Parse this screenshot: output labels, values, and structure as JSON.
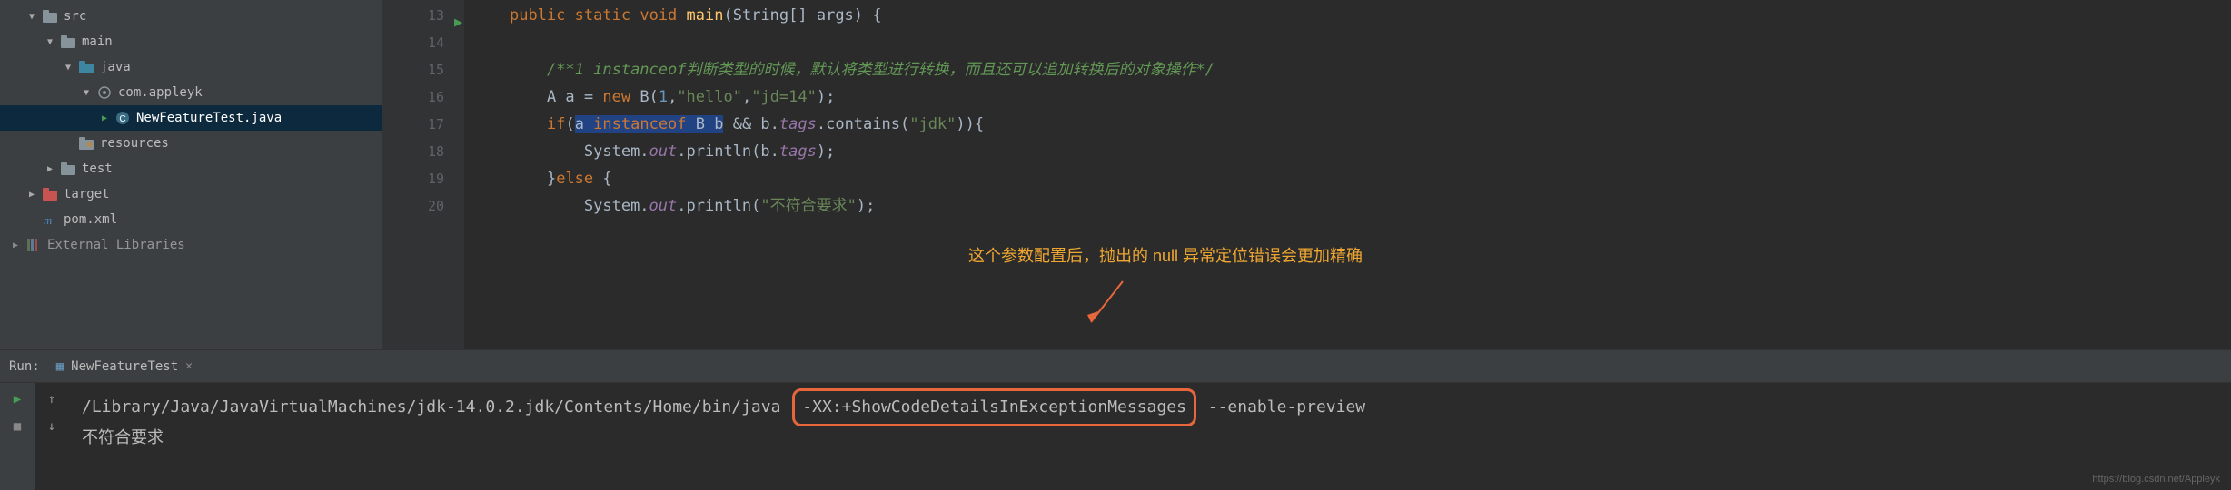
{
  "tree": {
    "src": "src",
    "main": "main",
    "java": "java",
    "package": "com.appleyk",
    "class": "NewFeatureTest.java",
    "resources": "resources",
    "test": "test",
    "target": "target",
    "pom": "pom.xml",
    "extlibs": "External Libraries"
  },
  "gutter": {
    "l13": "13",
    "l14": "14",
    "l15": "15",
    "l16": "16",
    "l17": "17",
    "l18": "18",
    "l19": "19",
    "l20": "20"
  },
  "code": {
    "l13": {
      "kw1": "public",
      "kw2": "static",
      "kw3": "void",
      "name": "main",
      "args": "(String[] args) {"
    },
    "l15": {
      "comment": "/**1 instanceof判断类型的时候，默认将类型进行转换，而且还可以追加转换后的对象操作*/"
    },
    "l16": {
      "part1": "A a = ",
      "kw": "new",
      "part2": " B(",
      "n": "1",
      "c1": ",",
      "s1": "\"hello\"",
      "c2": ",",
      "s2": "\"jd=14\"",
      "tail": ");"
    },
    "l17": {
      "ifkw": "if",
      "open": "(",
      "hl": "a instanceof B b",
      "amp": " && b.",
      "fld": "tags",
      "part2": ".contains(",
      "s": "\"jdk\"",
      "tail": ")){"
    },
    "l18": {
      "sys": "System.",
      "out": "out",
      "dot": ".println(b.",
      "fld": "tags",
      "tail": ");"
    },
    "l19": {
      "brace": "}",
      "elsekw": "else",
      "open": " {"
    },
    "l20": {
      "sys": "System.",
      "out": "out",
      "dot": ".println(",
      "s": "\"不符合要求\"",
      "tail": ");"
    }
  },
  "annotation": "这个参数配置后，抛出的 null 异常定位错误会更加精确",
  "run": {
    "label": "Run:",
    "tab": "NewFeatureTest",
    "cmd_pre": "/Library/Java/JavaVirtualMachines/jdk-14.0.2.jdk/Contents/Home/bin/java ",
    "cmd_hl": "-XX:+ShowCodeDetailsInExceptionMessages",
    "cmd_post": " --enable-preview",
    "out_line": "不符合要求"
  },
  "watermark": "https://blog.csdn.net/Appleyk"
}
